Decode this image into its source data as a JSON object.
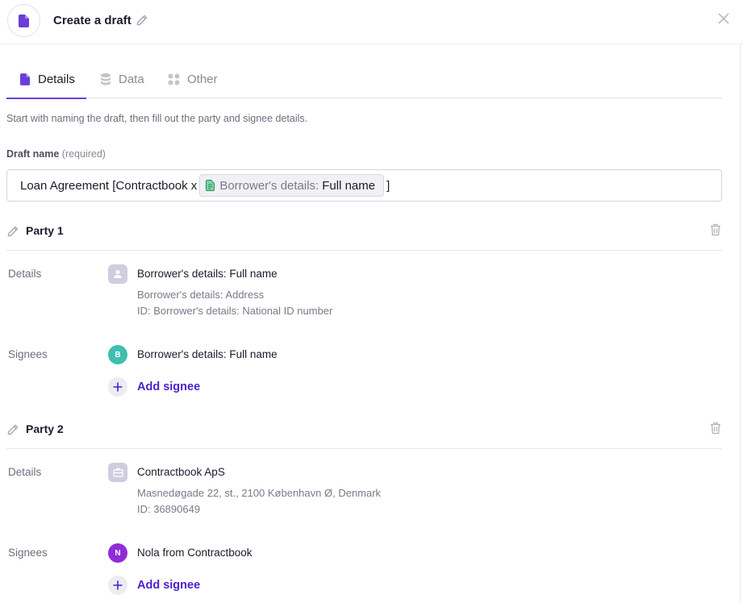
{
  "header": {
    "title": "Create a draft",
    "icon": "document-icon",
    "accent_color": "#6b3ddb"
  },
  "tabs": [
    {
      "label": "Details",
      "icon": "document-icon",
      "active": true
    },
    {
      "label": "Data",
      "icon": "database-icon",
      "active": false
    },
    {
      "label": "Other",
      "icon": "grid-icon",
      "active": false
    }
  ],
  "intro_text": "Start with naming the draft, then fill out the party and signee details.",
  "draft_name": {
    "label": "Draft name",
    "required_text": "(required)",
    "value_prefix": "Loan Agreement [Contractbook x",
    "chip_ref": "Borrower's details:",
    "chip_field": "Full name",
    "value_suffix": "]"
  },
  "parties": [
    {
      "title": "Party 1",
      "details_label": "Details",
      "details_icon": "person-icon",
      "details_name": "Borrower's details: Full name",
      "details_lines": [
        "Borrower's details: Address",
        "ID: Borrower's details: National ID number"
      ],
      "signees_label": "Signees",
      "signees": [
        {
          "initial": "B",
          "name": "Borrower's details: Full name",
          "color": "#3fbfad"
        }
      ],
      "add_signee_label": "Add signee"
    },
    {
      "title": "Party 2",
      "details_label": "Details",
      "details_icon": "company-icon",
      "details_name": "Contractbook ApS",
      "details_lines": [
        "Masnedøgade 22, st., 2100 København Ø, Denmark",
        "ID: 36890649"
      ],
      "signees_label": "Signees",
      "signees": [
        {
          "initial": "N",
          "name": "Nola from Contractbook",
          "color": "#8f2bd8"
        }
      ],
      "add_signee_label": "Add signee"
    }
  ]
}
